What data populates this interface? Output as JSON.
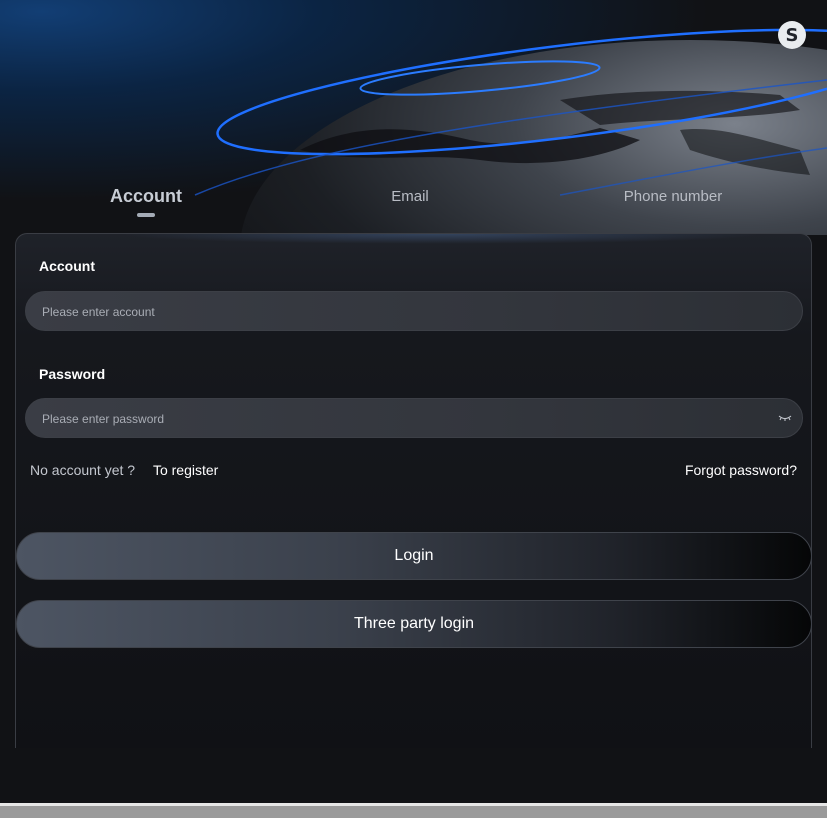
{
  "tabs": [
    {
      "label": "Account",
      "active": true
    },
    {
      "label": "Email",
      "active": false
    },
    {
      "label": "Phone number",
      "active": false
    }
  ],
  "form": {
    "account_label": "Account",
    "account_placeholder": "Please enter account",
    "account_value": "",
    "password_label": "Password",
    "password_placeholder": "Please enter password",
    "password_value": "",
    "password_toggle_icon": "eye-closed-icon"
  },
  "links": {
    "no_account": "No account yet ?",
    "register": "To register",
    "forgot": "Forgot password?"
  },
  "buttons": {
    "login": "Login",
    "three_party": "Three party login"
  },
  "colors": {
    "background": "#111215",
    "accent_blue": "#1f6fff",
    "button_start": "#4d5563",
    "button_end": "#050607"
  }
}
